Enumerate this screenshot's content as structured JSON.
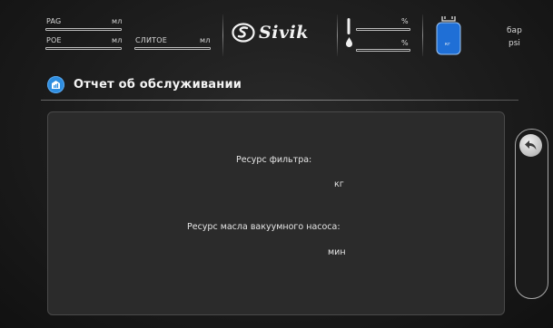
{
  "header": {
    "pag_label": "PAG",
    "pag_unit": "мл",
    "poe_label": "POE",
    "poe_unit": "мл",
    "drain_label": "СЛИТОЕ",
    "drain_unit": "мл",
    "brand": "Sivik",
    "temp_unit": "%",
    "humidity_unit": "%",
    "tank_unit": "кг",
    "pressure_unit_bar": "бар",
    "pressure_unit_psi": "psi",
    "tank_color": "#1f6fd6"
  },
  "page": {
    "title": "Отчет об обслуживании",
    "title_icon": "maintenance-report-icon",
    "accent": "#2e8de0"
  },
  "report": {
    "filter_label": "Ресурс фильтра:",
    "filter_unit": "кг",
    "vacuum_oil_label": "Ресурс масла вакуумного насоса:",
    "vacuum_oil_unit": "мин"
  },
  "side": {
    "back_icon": "back-arrow-icon"
  }
}
